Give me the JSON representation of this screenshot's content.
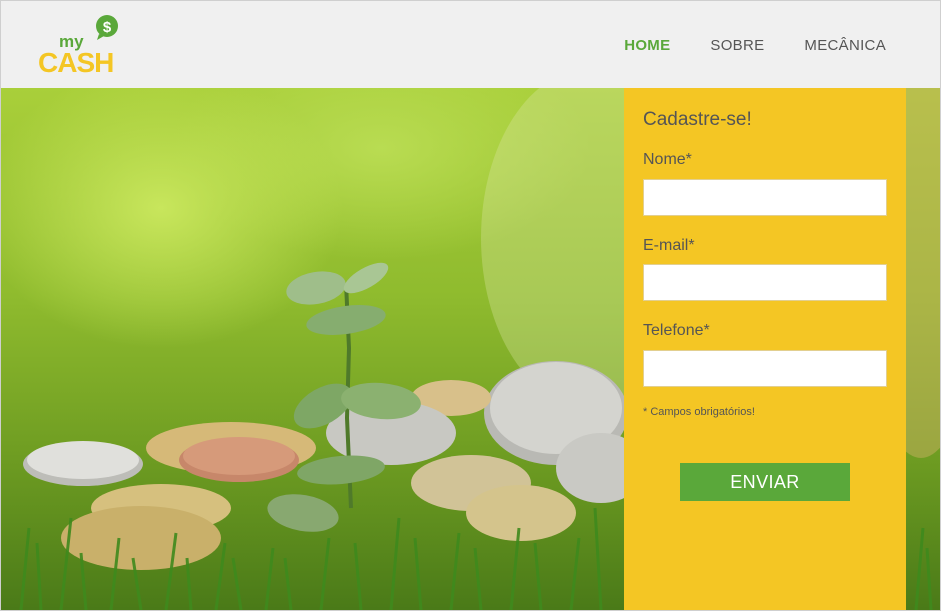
{
  "brand": {
    "logo_top": "my",
    "logo_bottom": "CASH",
    "badge": "$"
  },
  "nav": {
    "items": [
      {
        "label": "HOME"
      },
      {
        "label": "SOBRE"
      },
      {
        "label": "MECÂNICA"
      }
    ]
  },
  "form": {
    "title": "Cadastre-se!",
    "fields": [
      {
        "label": "Nome*",
        "value": ""
      },
      {
        "label": "E-mail*",
        "value": ""
      },
      {
        "label": "Telefone*",
        "value": ""
      }
    ],
    "required_note": "* Campos obrigatórios!",
    "submit_label": "ENVIAR"
  },
  "colors": {
    "accent_green": "#5aa83a",
    "panel_yellow": "#f4c624",
    "header_bg": "#f0f0f0"
  }
}
